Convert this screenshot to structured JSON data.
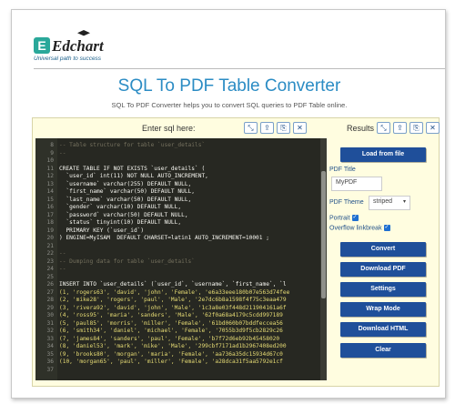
{
  "brand": {
    "logo_letter": "E",
    "name": "Edchart",
    "tagline": "Universal path to success"
  },
  "header": {
    "title": "SQL To PDF Table Converter",
    "subtitle": "SQL To PDF Converter helps you to convert SQL queries to PDF Table online."
  },
  "editor": {
    "heading": "Enter sql here:",
    "toolbar": [
      "⤡",
      "⇪",
      "⎘",
      "✕"
    ],
    "lines": [
      {
        "n": "8",
        "t": "-- Table structure for table `user_details`",
        "c": "#75715e"
      },
      {
        "n": "9",
        "t": "--",
        "c": "#75715e"
      },
      {
        "n": "10",
        "t": "",
        "c": "#f8f8f2"
      },
      {
        "n": "11",
        "t": "CREATE TABLE IF NOT EXISTS `user_details` (",
        "c": "#f8f8f2"
      },
      {
        "n": "12",
        "t": "  `user_id` int(11) NOT NULL AUTO_INCREMENT,",
        "c": "#f8f8f2"
      },
      {
        "n": "13",
        "t": "  `username` varchar(255) DEFAULT NULL,",
        "c": "#f8f8f2"
      },
      {
        "n": "14",
        "t": "  `first_name` varchar(50) DEFAULT NULL,",
        "c": "#f8f8f2"
      },
      {
        "n": "15",
        "t": "  `last_name` varchar(50) DEFAULT NULL,",
        "c": "#f8f8f2"
      },
      {
        "n": "16",
        "t": "  `gender` varchar(10) DEFAULT NULL,",
        "c": "#f8f8f2"
      },
      {
        "n": "17",
        "t": "  `password` varchar(50) DEFAULT NULL,",
        "c": "#f8f8f2"
      },
      {
        "n": "18",
        "t": "  `status` tinyint(10) DEFAULT NULL,",
        "c": "#f8f8f2"
      },
      {
        "n": "19",
        "t": "  PRIMARY KEY (`user_id`)",
        "c": "#f8f8f2"
      },
      {
        "n": "20",
        "t": ") ENGINE=MyISAM  DEFAULT CHARSET=latin1 AUTO_INCREMENT=10001 ;",
        "c": "#f8f8f2"
      },
      {
        "n": "21",
        "t": "",
        "c": "#f8f8f2"
      },
      {
        "n": "22",
        "t": "--",
        "c": "#75715e"
      },
      {
        "n": "23",
        "t": "-- Dumping data for table `user_details`",
        "c": "#75715e"
      },
      {
        "n": "24",
        "t": "--",
        "c": "#75715e"
      },
      {
        "n": "25",
        "t": "",
        "c": "#f8f8f2"
      },
      {
        "n": "26",
        "t": "INSERT INTO `user_details` (`user_id`, `username`, `first_name`, `l",
        "c": "#f8f8f2"
      },
      {
        "n": "27",
        "t": "(1, 'rogers63', 'david', 'john', 'Female', 'e6a33eee180b07e563d74fee",
        "c": "#e6db74"
      },
      {
        "n": "28",
        "t": "(2, 'mike28', 'rogers', 'paul', 'Male', '2e7dc6b8a1598f4f75c3eaa479",
        "c": "#e6db74"
      },
      {
        "n": "29",
        "t": "(3, 'rivera92', 'david', 'john', 'Male', '1c3a8e03f448d211904161a6f",
        "c": "#e6db74"
      },
      {
        "n": "30",
        "t": "(4, 'ross95', 'maria', 'sanders', 'Male', '62f0a68a4179c5cdd997189",
        "c": "#e6db74"
      },
      {
        "n": "31",
        "t": "(5, 'paul85', 'morris', 'miller', 'Female', '61bd060b07bddfeccea56",
        "c": "#e6db74"
      },
      {
        "n": "32",
        "t": "(6, 'smith34', 'daniel', 'michael', 'Female', '7055b3d9f5cb2829c26",
        "c": "#e6db74"
      },
      {
        "n": "33",
        "t": "(7, 'james84', 'sanders', 'paul', 'Female', 'b7f72d6eb92b45458020",
        "c": "#e6db74"
      },
      {
        "n": "34",
        "t": "(8, 'daniel53', 'mark', 'mike', 'Male', '299cbf7171ad1b2967408ed200",
        "c": "#e6db74"
      },
      {
        "n": "35",
        "t": "(9, 'brooks80', 'morgan', 'maria', 'Female', 'aa736a35dc15934d67c0",
        "c": "#e6db74"
      },
      {
        "n": "36",
        "t": "(10, 'morgan65', 'paul', 'miller', 'Female', 'a28dca31f5aa5792e1cf",
        "c": "#e6db74"
      },
      {
        "n": "37",
        "t": "",
        "c": "#f8f8f2"
      }
    ]
  },
  "results": {
    "heading": "Results",
    "toolbar": [
      "⤡",
      "⇪",
      "⎘",
      "✕"
    ],
    "load_button": "Load from file",
    "pdf_title_label": "PDF Title",
    "pdf_title_value": "MyPDF",
    "pdf_theme_label": "PDF Theme",
    "pdf_theme_value": "striped",
    "portrait_label": "Portrait",
    "overflow_label": "Overflow linkbreak",
    "buttons": [
      "Convert",
      "Download PDF",
      "Settings",
      "Wrap Mode",
      "Download HTML",
      "Clear"
    ]
  },
  "colors": {
    "accent": "#2b8cc4",
    "button": "#1f4f9a",
    "editor_bg": "#272822",
    "panel_bg": "#fffde0"
  }
}
